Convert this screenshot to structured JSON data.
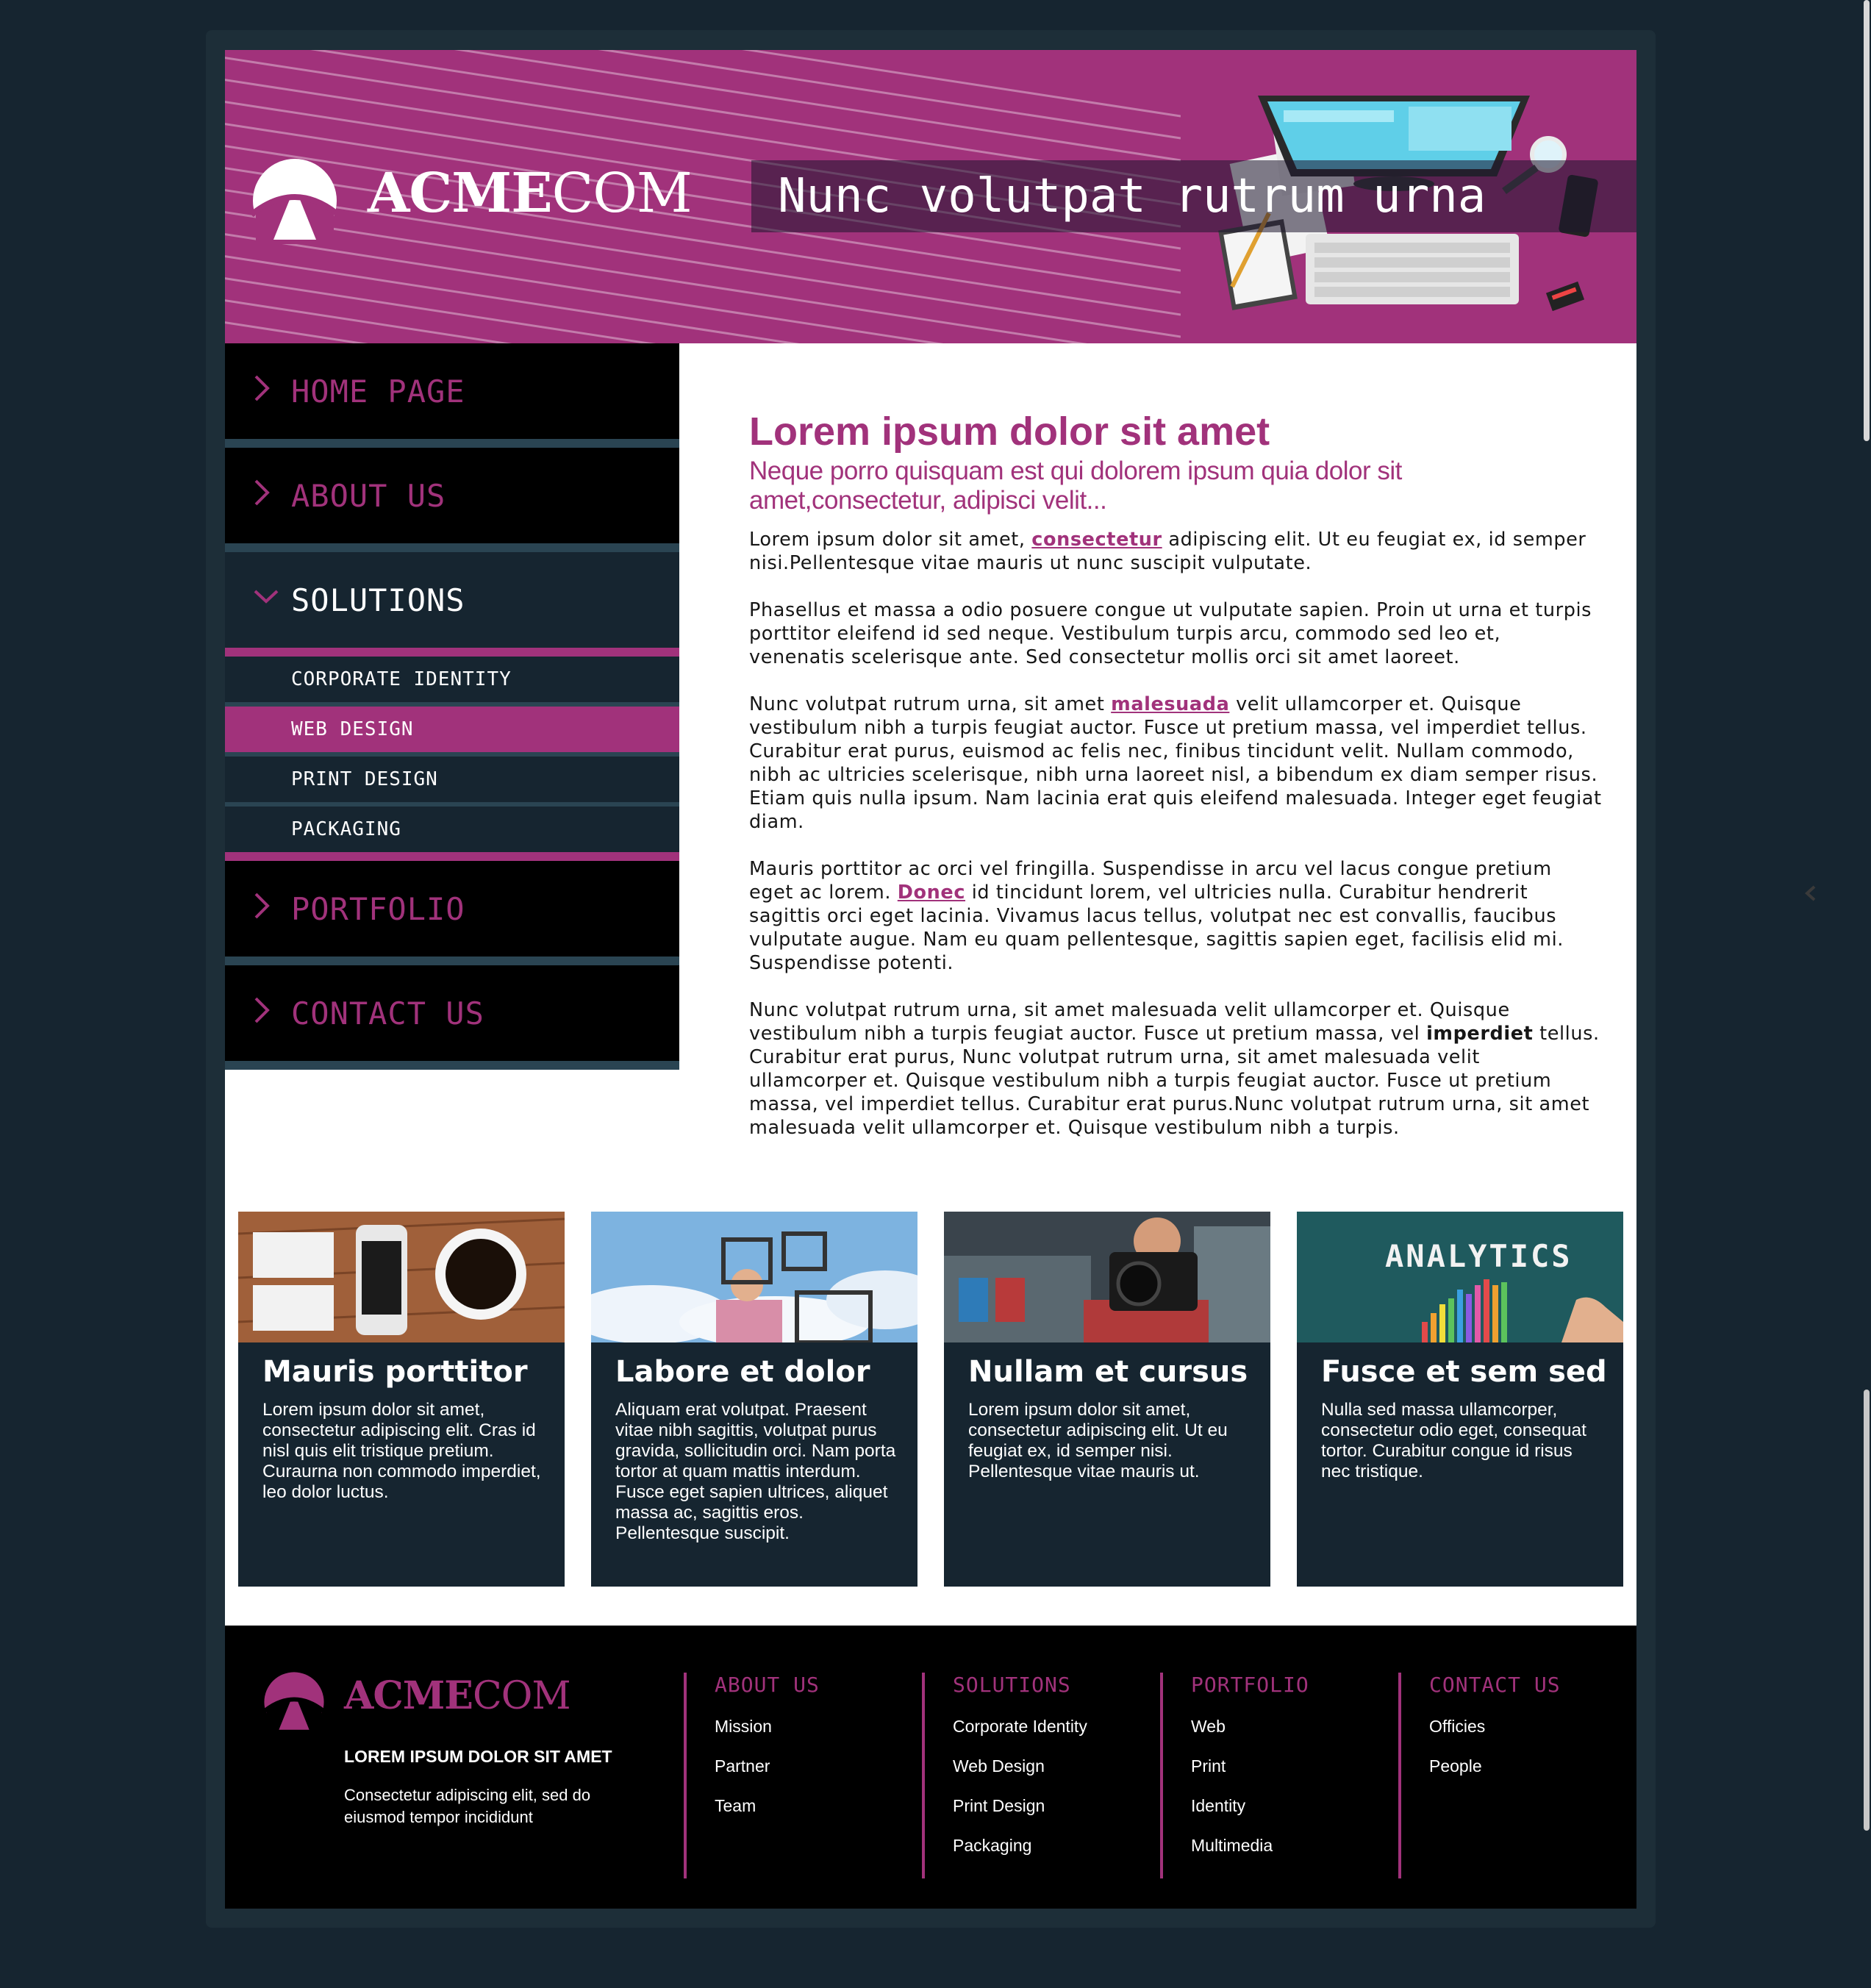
{
  "brand": {
    "logo_bold": "ACME",
    "logo_light": "COM",
    "tagline": "Nunc volutpat rutrum urna"
  },
  "colors": {
    "accent": "#a1327b",
    "dark": "#162530",
    "black": "#000000",
    "nav_separator": "#2a4452",
    "background": "#162530"
  },
  "nav": {
    "items": [
      {
        "label": "HOME PAGE",
        "icon": "chevron-right-icon"
      },
      {
        "label": "ABOUT US",
        "icon": "chevron-right-icon"
      },
      {
        "label": "SOLUTIONS",
        "icon": "chevron-down-icon",
        "expanded": true
      },
      {
        "label": "PORTFOLIO",
        "icon": "chevron-right-icon"
      },
      {
        "label": "CONTACT US",
        "icon": "chevron-right-icon"
      }
    ],
    "solutions_sub": [
      {
        "label": "CORPORATE IDENTITY"
      },
      {
        "label": "WEB DESIGN",
        "active": true
      },
      {
        "label": "PRINT DESIGN"
      },
      {
        "label": "PACKAGING"
      }
    ]
  },
  "main": {
    "title": "Lorem ipsum dolor sit amet",
    "subtitle": "Neque porro quisquam est qui dolorem ipsum quia dolor sit amet,consectetur, adipisci velit...",
    "p1": {
      "a": "Lorem ipsum dolor sit amet, ",
      "link": "consectetur",
      "b": " adipiscing elit. Ut eu feugiat ex, id semper nisi.Pellentesque vitae mauris ut nunc suscipit vulputate."
    },
    "p2": "Phasellus et massa a odio posuere congue ut vulputate sapien. Proin ut urna et turpis porttitor eleifend id sed neque. Vestibulum turpis arcu, commodo sed leo et, venenatis scelerisque ante. Sed consectetur mollis orci sit amet laoreet.",
    "p3": {
      "a": "Nunc volutpat rutrum urna, sit amet ",
      "link": "malesuada",
      "b": " velit ullamcorper et. Quisque vestibulum nibh a turpis feugiat auctor. Fusce ut pretium massa, vel imperdiet tellus. Curabitur erat purus, euismod ac felis nec, finibus tincidunt velit. Nullam commodo, nibh ac ultricies scelerisque, nibh urna laoreet nisl, a bibendum ex diam semper risus. Etiam quis nulla ipsum. Nam lacinia erat quis eleifend malesuada. Integer eget feugiat diam."
    },
    "p4": {
      "a": "Mauris porttitor ac orci vel fringilla. Suspendisse in arcu vel lacus congue pretium eget ac lorem. ",
      "link": "Donec",
      "b": " id tincidunt lorem, vel ultricies nulla. Curabitur hendrerit sagittis orci eget lacinia. Vivamus lacus tellus, volutpat nec est convallis, faucibus vulputate augue. Nam eu quam pellentesque, sagittis sapien eget, facilisis elid mi. Suspendisse potenti."
    },
    "p5": {
      "a": "Nunc volutpat rutrum urna, sit amet malesuada velit ullamcorper et. Quisque vestibulum nibh a turpis feugiat auctor. Fusce ut pretium massa, vel ",
      "bold": "imperdiet",
      "b": " tellus. Curabitur erat purus, Nunc volutpat rutrum urna, sit amet malesuada velit ullamcorper et. Quisque vestibulum nibh a turpis feugiat auctor. Fusce ut pretium massa, vel imperdiet tellus. Curabitur erat purus.Nunc volutpat rutrum urna, sit amet malesuada velit ullamcorper et. Quisque vestibulum nibh a turpis."
    }
  },
  "cards": [
    {
      "title": "Mauris porttitor",
      "text": "Lorem ipsum dolor sit amet, consectetur adipiscing elit. Cras id nisl quis elit tristique pretium. Curaurna non commodo imperdiet, leo dolor luctus.",
      "image": "phone-coffee-desk-photo"
    },
    {
      "title": "Labore et dolor",
      "text": "Aliquam erat volutpat. Praesent vitae nibh sagittis, volutpat purus gravida, sollicitudin orci. Nam porta tortor at quam mattis interdum. Fusce eget sapien ultrices, aliquet massa ac, sagittis eros. Pellentesque suscipit.",
      "image": "frames-sky-photo"
    },
    {
      "title": "Nullam et cursus",
      "text": "Lorem ipsum dolor sit amet, consectetur adipiscing elit. Ut eu feugiat ex, id semper nisi. Pellentesque vitae mauris ut.",
      "image": "photographer-camera-photo"
    },
    {
      "title": "Fusce et sem sed",
      "text": "Nulla sed massa ullamcorper, consectetur odio eget, consequat tortor. Curabitur congue id risus nec tristique.",
      "image": "analytics-chalkboard-photo",
      "image_text": "ANALYTICS"
    }
  ],
  "footer": {
    "logo_bold": "ACME",
    "logo_light": "COM",
    "heading": "LOREM IPSUM DOLOR SIT AMET",
    "desc": "Consectetur adipiscing elit, sed do eiusmod tempor incididunt",
    "columns": [
      {
        "title": "ABOUT US",
        "links": [
          "Mission",
          "Partner",
          "Team"
        ]
      },
      {
        "title": "SOLUTIONS",
        "links": [
          "Corporate Identity",
          "Web Design",
          "Print Design",
          "Packaging"
        ]
      },
      {
        "title": "PORTFOLIO",
        "links": [
          "Web",
          "Print",
          "Identity",
          "Multimedia"
        ]
      },
      {
        "title": "CONTACT US",
        "links": [
          "Officies",
          "People"
        ]
      }
    ]
  }
}
